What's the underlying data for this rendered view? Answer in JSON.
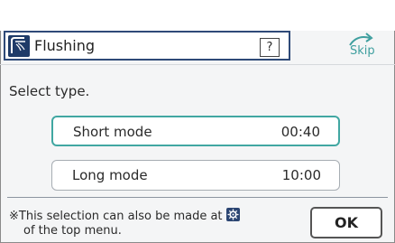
{
  "header": {
    "title": "Flushing",
    "help_label": "?",
    "skip_label": "Skip"
  },
  "content": {
    "prompt": "Select type.",
    "modes": [
      {
        "label": "Short mode",
        "time": "00:40",
        "selected": true
      },
      {
        "label": "Long mode",
        "time": "10:00",
        "selected": false
      }
    ],
    "note_line1_a": "※This selection can also be made at",
    "note_line2": "of the top menu.",
    "ok_label": "OK"
  },
  "icons": {
    "header_icon": "flushing-icon",
    "skip_icon": "skip-arrow-icon",
    "note_icon": "gear-icon"
  },
  "colors": {
    "accent": "#41a7a2",
    "header_border": "#2f4a78",
    "icon_bg": "#1f3b68"
  }
}
